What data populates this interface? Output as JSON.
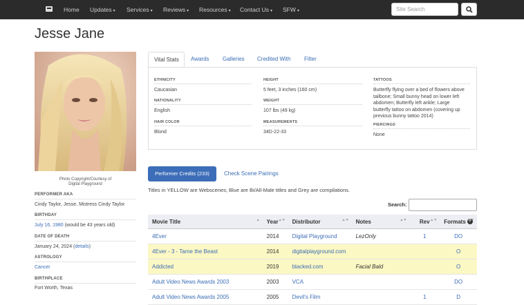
{
  "nav": {
    "items": [
      {
        "label": "Home",
        "dropdown": false
      },
      {
        "label": "Updates",
        "dropdown": true
      },
      {
        "label": "Services",
        "dropdown": true
      },
      {
        "label": "Reviews",
        "dropdown": true
      },
      {
        "label": "Resources",
        "dropdown": true
      },
      {
        "label": "Contact Us",
        "dropdown": true
      },
      {
        "label": "SFW",
        "dropdown": true
      }
    ],
    "search_placeholder": "Site Search"
  },
  "title": "Jesse Jane",
  "photo_caption_line1": "Photo Copyright/Courtesy of",
  "photo_caption_line2": "Digital Playground",
  "side": {
    "aka_label": "PERFORMER AKA",
    "aka_value": "Cindy Taylor, Jesse, Mistress Cindy Taylor",
    "birthday_label": "BIRTHDAY",
    "birthday_link": "July 16, 1980",
    "birthday_suffix": " (would be 43 years old)",
    "death_label": "DATE OF DEATH",
    "death_value": "January 24, 2024 (",
    "death_link": "details",
    "death_close": ")",
    "astro_label": "ASTROLOGY",
    "astro_value": "Cancer",
    "birthplace_label": "BIRTHPLACE",
    "birthplace_value": "Fort Worth, Texas"
  },
  "tabs": [
    "Vital Stats",
    "Awards",
    "Galleries",
    "Credited With",
    "Filter"
  ],
  "stats": {
    "ethnicity_label": "ETHNICITY",
    "ethnicity": "Caucasian",
    "nationality_label": "NATIONALITY",
    "nationality": "English",
    "hair_label": "HAIR COLOR",
    "hair": "Blond",
    "height_label": "HEIGHT",
    "height": "5 feet, 3 inches (160 cm)",
    "weight_label": "WEIGHT",
    "weight": "107 lbs (49 kg)",
    "measurements_label": "MEASUREMENTS",
    "measurements": "34D-22-33",
    "tattoos_label": "TATTOOS",
    "tattoos_lines": [
      "Butterfly flying over a bed of flowers above",
      "tailbone; Small bunny head on lower left",
      "abdomen; Butterfly left ankle; Large",
      "butterfly tattoo on abdomen (covering up",
      "previous bunny tattoo 2014)"
    ],
    "piercings_label": "PIERCINGS",
    "piercings": "None"
  },
  "credits": {
    "button": "Performer Credits (233)",
    "pairings_link": "Check Scene Pairings",
    "legend": "Titles in YELLOW are Webscenes; Blue are Bi/All-Male titles and Grey are compilations.",
    "search_label": "Search:",
    "columns": [
      "Movie Title",
      "Year",
      "Distributor",
      "Notes",
      "Rev",
      "Formats"
    ],
    "rows": [
      {
        "title": "4Ever",
        "year": "2014",
        "distributor": "Digital Playground",
        "notes": "LezOnly",
        "rev": "1",
        "formats": "DO",
        "yellow": false
      },
      {
        "title": "4Ever - 3 - Tame the Beast",
        "year": "2014",
        "distributor": "digitalplayground.com",
        "notes": "",
        "rev": "",
        "formats": "O",
        "yellow": true
      },
      {
        "title": "Addicted",
        "year": "2019",
        "distributor": "blacked.com",
        "notes": "Facial Bald",
        "rev": "",
        "formats": "O",
        "yellow": true
      },
      {
        "title": "Adult Video News Awards 2003",
        "year": "2003",
        "distributor": "VCA",
        "notes": "",
        "rev": "",
        "formats": "DO",
        "yellow": false
      },
      {
        "title": "Adult Video News Awards 2005",
        "year": "2005",
        "distributor": "Devil's Film",
        "notes": "",
        "rev": "1",
        "formats": "D",
        "yellow": false
      }
    ]
  },
  "colors": {
    "navbar": "#2b2b2b",
    "link": "#3a6cb5",
    "button": "#3c6db8",
    "webscene_row": "#fcf8c4",
    "table_header": "#eceef3"
  }
}
